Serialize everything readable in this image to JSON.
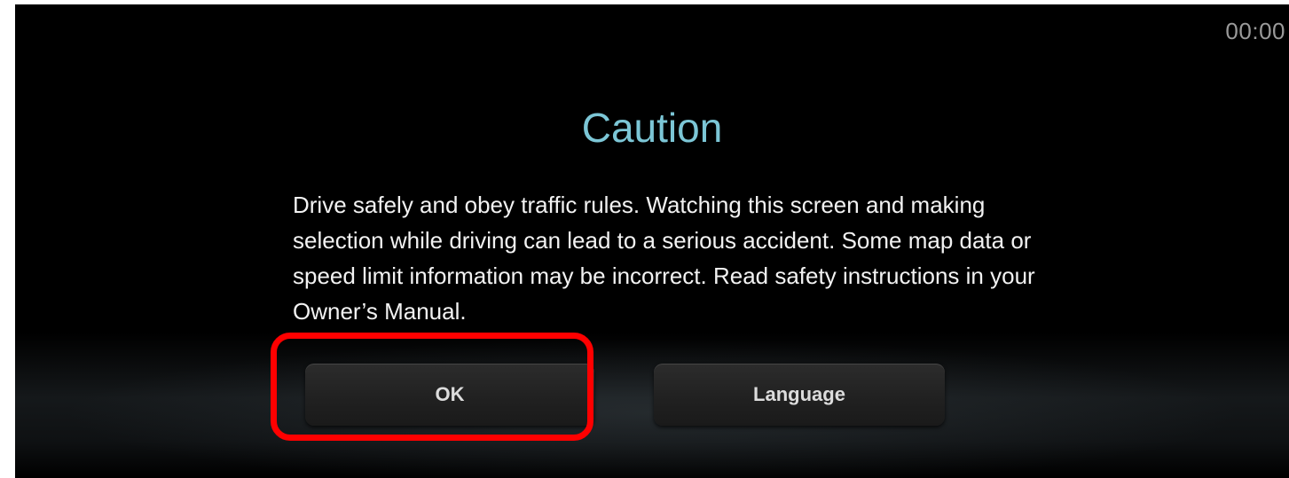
{
  "status_bar": {
    "clock": "00:00"
  },
  "dialog": {
    "title": "Caution",
    "message": "Drive safely and obey traffic rules. Watching this screen and making selection while driving can lead to a serious accident. Some map data or speed limit information may be incorrect. Read safety instructions in your Owner’s Manual.",
    "buttons": {
      "ok_label": "OK",
      "language_label": "Language"
    }
  },
  "colors": {
    "title": "#7cc6d6",
    "background": "#000000",
    "highlight": "#ff0000"
  }
}
